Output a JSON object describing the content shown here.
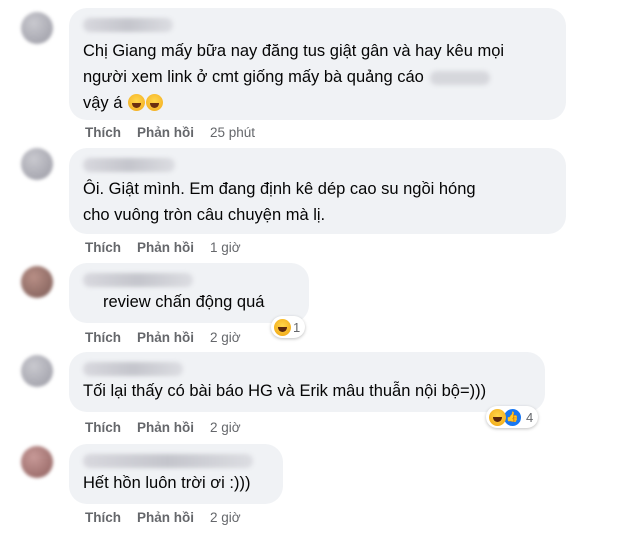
{
  "labels": {
    "like": "Thích",
    "reply": "Phản hồi"
  },
  "comments": [
    {
      "lines": [
        "Chị Giang mấy bữa nay đăng tus giật gân và hay kêu mọi",
        "người xem link ở cmt giống mấy bà quảng cáo"
      ],
      "last_line": "vậy á",
      "emoji": [
        "rolling-laughing-emoji",
        "rolling-laughing-emoji"
      ],
      "time": "25 phút"
    },
    {
      "lines": [
        "Ôi. Giật mình. Em đang định kê dép cao su ngồi hóng",
        "cho vuông tròn câu chuyện mà lị."
      ],
      "time": "1 giờ"
    },
    {
      "lines": [
        "review chấn động quá"
      ],
      "time": "2 giờ",
      "reaction": {
        "icons": [
          "haha-icon"
        ],
        "count": "1"
      }
    },
    {
      "lines": [
        "Tối lại thấy có bài báo HG và Erik mâu thuẫn nội bộ=)))"
      ],
      "time": "2 giờ",
      "reaction": {
        "icons": [
          "haha-icon",
          "like-icon"
        ],
        "count": "4"
      }
    },
    {
      "lines": [
        "Hết hồn luôn trời ơi :)))"
      ],
      "time": "2 giờ"
    }
  ],
  "colors": {
    "bubble": "#f0f2f5",
    "meta": "#65676b",
    "like_blue": "#1877f2"
  }
}
